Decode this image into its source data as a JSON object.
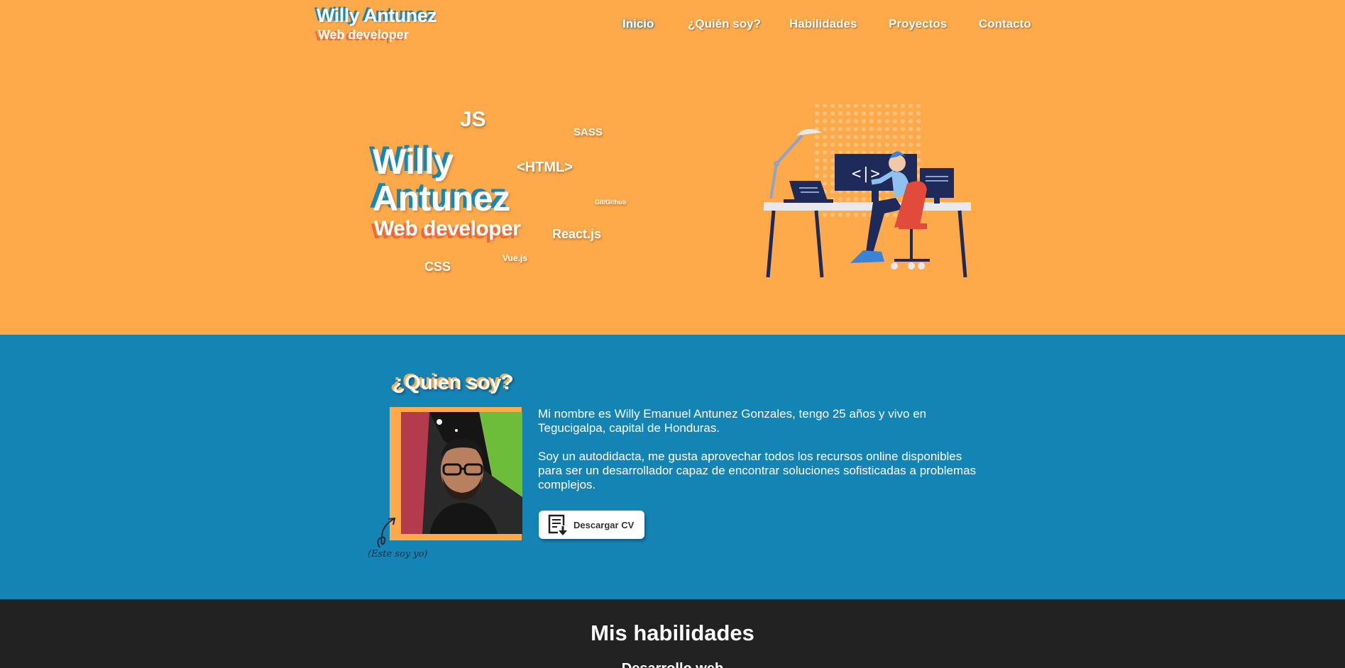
{
  "header": {
    "brand_name": "Willy Antunez",
    "brand_role": "Web developer",
    "nav": [
      {
        "label": "Inicio"
      },
      {
        "label": "¿Quién soy?"
      },
      {
        "label": "Habilidades"
      },
      {
        "label": "Proyectos"
      },
      {
        "label": "Contacto"
      }
    ]
  },
  "hero": {
    "title_line1": "Willy",
    "title_line2": "Antunez",
    "role": "Web developer",
    "tech_cloud": [
      "JS",
      "SASS",
      "<HTML>",
      "Git/Github",
      "React.js",
      "Vue.js",
      "CSS"
    ],
    "illustration_icon": "developer-at-desk-illustration"
  },
  "about": {
    "title": "¿Quien soy?",
    "paragraph1": "Mi nombre es Willy Emanuel Antunez Gonzales, tengo 25 años y vivo en Tegucigalpa, capital de Honduras.",
    "paragraph2": "Soy un autodidacta, me gusta aprovechar todos los recursos online disponibles para ser un desarrollador capaz de encontrar soluciones sofisticadas a problemas complejos.",
    "photo_caption": "(Este soy yo)",
    "cv_button_label": "Descargar CV",
    "cv_button_icon": "download-document-icon"
  },
  "skills": {
    "title": "Mis habilidades",
    "subtitle": "Desarrollo web"
  },
  "colors": {
    "hero_bg": "#ffaa4a",
    "about_bg": "#1484b5",
    "skills_bg": "#222222",
    "accent_blue": "#1487b8",
    "accent_red": "#f2643a"
  }
}
